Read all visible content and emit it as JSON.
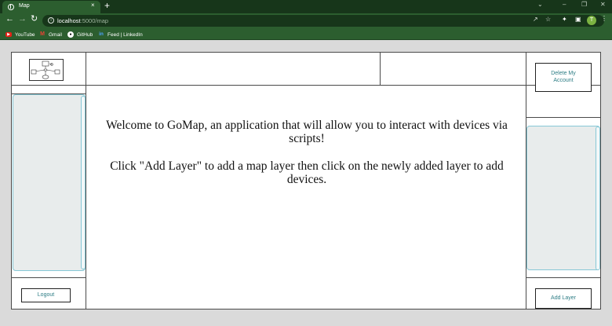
{
  "browser": {
    "tab_title": "Map",
    "tab_close": "×",
    "new_tab": "+",
    "url_host": "localhost",
    "url_path": ":5000/map",
    "profile_initial": "T",
    "bookmarks": [
      {
        "label": "YouTube",
        "icon": "youtube-icon"
      },
      {
        "label": "Gmail",
        "icon": "gmail-icon"
      },
      {
        "label": "GitHub",
        "icon": "github-icon"
      },
      {
        "label": "Feed | LinkedIn",
        "icon": "linkedin-icon"
      }
    ],
    "theme_colors": {
      "frame": "#17361a",
      "toolbar": "#2c5e2f"
    }
  },
  "app": {
    "logout_label": "Logout",
    "delete_account_label": "Delete My Account",
    "add_layer_label": "Add Layer",
    "welcome_line1": "Welcome to GoMap, an application that will allow you to interact with devices via scripts!",
    "welcome_line2": "Click \"Add Layer\" to add a map layer then click on the newly added layer to add devices.",
    "colors": {
      "button_text": "#2e7d85",
      "panel_border": "#87c8d6",
      "panel_fill": "#e8ecec"
    }
  }
}
